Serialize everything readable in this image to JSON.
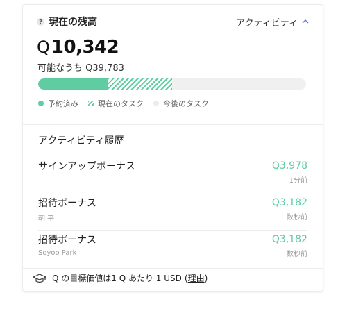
{
  "header": {
    "help": "?",
    "title": "現在の残高",
    "activity_label": "アクティビティ"
  },
  "balance": {
    "symbol": "Q",
    "amount": "10,342",
    "available_label": "可能なうち",
    "available_value": "Q39,783"
  },
  "progress": {
    "done_fraction": 0.26,
    "current_fraction": 0.24
  },
  "legend": [
    {
      "label": "予約済み"
    },
    {
      "label": "現在のタスク"
    },
    {
      "label": "今後のタスク"
    }
  ],
  "history": {
    "title": "アクティビティ履歴",
    "rows": [
      {
        "name": "サインアップボーナス",
        "sub": "",
        "amount": "Q3,978",
        "time": "1分前"
      },
      {
        "name": "招待ボーナス",
        "sub": "朝 平",
        "amount": "Q3,182",
        "time": "数秒前"
      },
      {
        "name": "招待ボーナス",
        "sub": "Soyoo Park",
        "amount": "Q3,182",
        "time": "数秒前"
      }
    ]
  },
  "footer": {
    "text": "Q の目標価値は1 Q あたり 1 USD",
    "open_paren": "(",
    "link": "理由",
    "close_paren": ")"
  },
  "colors": {
    "accent": "#5fcca2"
  }
}
